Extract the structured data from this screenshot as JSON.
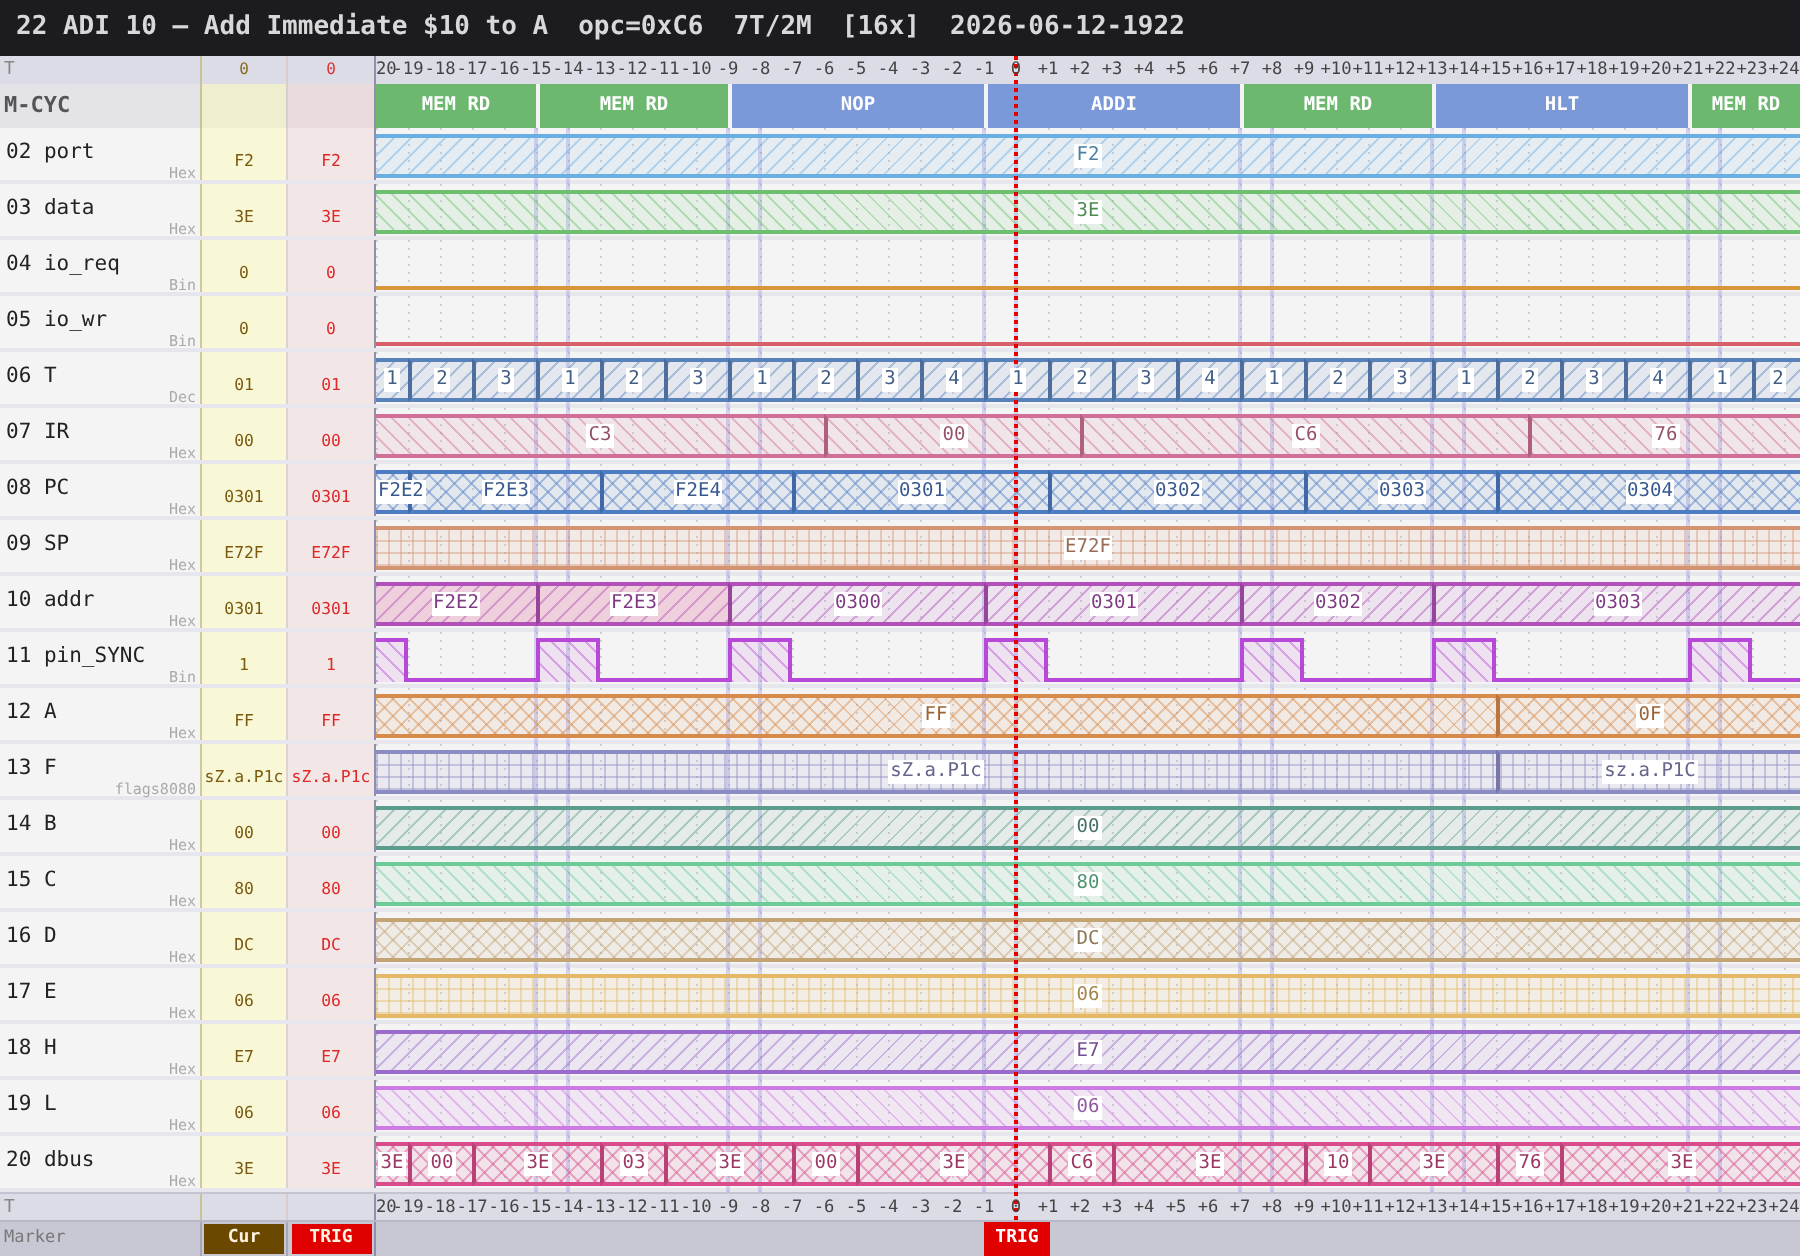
{
  "title_bar": {
    "title": "22 ADI 10 — Add Immediate $10 to A",
    "opcode": "opc=0xC6",
    "timing": "7T/2M",
    "zoom": "[16x]",
    "timestamp": "2026-06-12-1922"
  },
  "time_axis": {
    "label": "T",
    "cur": "0",
    "trig": "0",
    "ticks": [
      "20",
      "-19",
      "-18",
      "-17",
      "-16",
      "-15",
      "-14",
      "-13",
      "-12",
      "-11",
      "-10",
      "-9",
      "-8",
      "-7",
      "-6",
      "-5",
      "-4",
      "-3",
      "-2",
      "-1",
      "0",
      "+1",
      "+2",
      "+3",
      "+4",
      "+5",
      "+6",
      "+7",
      "+8",
      "+9",
      "+10",
      "+11",
      "+12",
      "+13",
      "+14",
      "+15",
      "+16",
      "+17",
      "+18",
      "+19",
      "+20",
      "+21",
      "+22",
      "+23",
      "+24"
    ]
  },
  "mcycle_row": {
    "label": "M-CYC",
    "cycles": [
      {
        "name": "MEM RD",
        "color": "#6cb86e"
      },
      {
        "name": "MEM RD",
        "color": "#6cb86e"
      },
      {
        "name": "NOP",
        "color": "#7b98d8"
      },
      {
        "name": "ADDI",
        "color": "#7b98d8"
      },
      {
        "name": "MEM RD",
        "color": "#6cb86e"
      },
      {
        "name": "HLT",
        "color": "#7b98d8"
      },
      {
        "name": "MEM RD",
        "color": "#6cb86e"
      }
    ]
  },
  "signals": [
    {
      "name": "02 port",
      "format": "Hex",
      "cur": "F2",
      "trig": "F2",
      "kind": "slash",
      "color": "#6aaee2",
      "segments": [
        {
          "value": "F2"
        }
      ]
    },
    {
      "name": "03 data",
      "format": "Hex",
      "cur": "3E",
      "trig": "3E",
      "kind": "backslash",
      "color": "#6cc070",
      "segments": [
        {
          "value": "3E"
        }
      ]
    },
    {
      "name": "04 io_req",
      "format": "Bin",
      "cur": "0",
      "trig": "0",
      "kind": "bit",
      "color": "#d8963a",
      "segments": [
        {
          "high": false
        }
      ]
    },
    {
      "name": "05 io_wr",
      "format": "Bin",
      "cur": "0",
      "trig": "0",
      "kind": "bit",
      "color": "#d8606a",
      "segments": [
        {
          "high": false
        }
      ]
    },
    {
      "name": "06 T",
      "format": "Dec",
      "cur": "01",
      "trig": "01",
      "kind": "slash",
      "color": "#5a82ba",
      "segments": [
        {
          "value": "1"
        },
        {
          "value": "2"
        },
        {
          "value": "3"
        },
        {
          "value": "1"
        },
        {
          "value": "2"
        },
        {
          "value": "3"
        },
        {
          "value": "1"
        },
        {
          "value": "2"
        },
        {
          "value": "3"
        },
        {
          "value": "4"
        },
        {
          "value": "1"
        },
        {
          "value": "2"
        },
        {
          "value": "3"
        },
        {
          "value": "4"
        },
        {
          "value": "1"
        },
        {
          "value": "2"
        },
        {
          "value": "3"
        },
        {
          "value": "1"
        },
        {
          "value": "2"
        },
        {
          "value": "3"
        },
        {
          "value": "4"
        },
        {
          "value": "1"
        },
        {
          "value": "2"
        }
      ]
    },
    {
      "name": "07 IR",
      "format": "Hex",
      "cur": "00",
      "trig": "00",
      "kind": "backslash",
      "color": "#d07098",
      "segments": [
        {
          "value": "C3"
        },
        {
          "value": "00"
        },
        {
          "value": "C6"
        },
        {
          "value": "76"
        }
      ]
    },
    {
      "name": "08 PC",
      "format": "Hex",
      "cur": "0301",
      "trig": "0301",
      "kind": "cross",
      "color": "#4d7cc4",
      "segments": [
        {
          "value": "F2E2"
        },
        {
          "value": "F2E3"
        },
        {
          "value": "F2E4"
        },
        {
          "value": "0301"
        },
        {
          "value": "0302"
        },
        {
          "value": "0303"
        },
        {
          "value": "0304"
        }
      ]
    },
    {
      "name": "09 SP",
      "format": "Hex",
      "cur": "E72F",
      "trig": "E72F",
      "kind": "grid",
      "color": "#d49474",
      "segments": [
        {
          "value": "E72F"
        }
      ]
    },
    {
      "name": "10 addr",
      "format": "Hex",
      "cur": "0301",
      "trig": "0301",
      "kind": "slash",
      "color": "#b050b8",
      "segments": [
        {
          "value": "F2E2",
          "highlighted": true
        },
        {
          "value": "F2E3",
          "highlighted": true
        },
        {
          "value": "0300",
          "highlighted": false
        },
        {
          "value": "0301",
          "highlighted": false
        },
        {
          "value": "0302",
          "highlighted": false
        },
        {
          "value": "0303",
          "highlighted": false
        }
      ]
    },
    {
      "name": "11 pin_SYNC",
      "format": "Bin",
      "cur": "1",
      "trig": "1",
      "kind": "bit",
      "color": "#b848d8",
      "segments": [
        {
          "high": true
        },
        {
          "high": false
        },
        {
          "high": true
        },
        {
          "high": false
        },
        {
          "high": true
        },
        {
          "high": false
        },
        {
          "high": true
        },
        {
          "high": false
        },
        {
          "high": true
        },
        {
          "high": false
        },
        {
          "high": true
        },
        {
          "high": false
        },
        {
          "high": true
        },
        {
          "high": false
        }
      ]
    },
    {
      "name": "12 A",
      "format": "Hex",
      "cur": "FF",
      "trig": "FF",
      "kind": "cross",
      "color": "#d88a4a",
      "segments": [
        {
          "value": "FF"
        },
        {
          "value": "0F"
        }
      ]
    },
    {
      "name": "13 F",
      "format": "flags8080",
      "cur": "sZ.a.P1c",
      "trig": "sZ.a.P1c",
      "kind": "grid",
      "color": "#8c8cc4",
      "segments": [
        {
          "value": "sZ.a.P1c"
        },
        {
          "value": "sz.a.P1C"
        }
      ]
    },
    {
      "name": "14 B",
      "format": "Hex",
      "cur": "00",
      "trig": "00",
      "kind": "slash",
      "color": "#5c9c8c",
      "segments": [
        {
          "value": "00"
        }
      ]
    },
    {
      "name": "15 C",
      "format": "Hex",
      "cur": "80",
      "trig": "80",
      "kind": "backslash",
      "color": "#6ccc98",
      "segments": [
        {
          "value": "80"
        }
      ]
    },
    {
      "name": "16 D",
      "format": "Hex",
      "cur": "DC",
      "trig": "DC",
      "kind": "cross",
      "color": "#c4a474",
      "segments": [
        {
          "value": "DC"
        }
      ]
    },
    {
      "name": "17 E",
      "format": "Hex",
      "cur": "06",
      "trig": "06",
      "kind": "grid",
      "color": "#e4b864",
      "segments": [
        {
          "value": "06"
        }
      ]
    },
    {
      "name": "18 H",
      "format": "Hex",
      "cur": "E7",
      "trig": "E7",
      "kind": "slash",
      "color": "#9a6acc",
      "segments": [
        {
          "value": "E7"
        }
      ]
    },
    {
      "name": "19 L",
      "format": "Hex",
      "cur": "06",
      "trig": "06",
      "kind": "backslash",
      "color": "#cc7ae4",
      "segments": [
        {
          "value": "06"
        }
      ]
    },
    {
      "name": "20 dbus",
      "format": "Hex",
      "cur": "3E",
      "trig": "3E",
      "kind": "cross",
      "color": "#d84c8c",
      "segments": [
        {
          "value": "3E"
        },
        {
          "value": "00"
        },
        {
          "value": "3E"
        },
        {
          "value": "03"
        },
        {
          "value": "3E"
        },
        {
          "value": "00"
        },
        {
          "value": "3E"
        },
        {
          "value": "C6"
        },
        {
          "value": "3E"
        },
        {
          "value": "10"
        },
        {
          "value": "3E"
        },
        {
          "value": "76"
        },
        {
          "value": "3E"
        }
      ]
    }
  ],
  "footer_axis": {
    "label": "T",
    "ticks": [
      "20",
      "-19",
      "-18",
      "-17",
      "-16",
      "-15",
      "-14",
      "-13",
      "-12",
      "-11",
      "-10",
      "-9",
      "-8",
      "-7",
      "-6",
      "-5",
      "-4",
      "-3",
      "-2",
      "-1",
      "0",
      "+1",
      "+2",
      "+3",
      "+4",
      "+5",
      "+6",
      "+7",
      "+8",
      "+9",
      "+10",
      "+11",
      "+12",
      "+13",
      "+14",
      "+15",
      "+16",
      "+17",
      "+18",
      "+19",
      "+20",
      "+21",
      "+22",
      "+23",
      "+24"
    ]
  },
  "marker_row": {
    "label": "Marker",
    "buttons": [
      {
        "label": "Cur",
        "color": "#6a4800"
      },
      {
        "label": "TRIG",
        "color": "#e00000"
      }
    ],
    "markers": [
      {
        "label": "TRIG",
        "color": "#e00000"
      }
    ]
  }
}
